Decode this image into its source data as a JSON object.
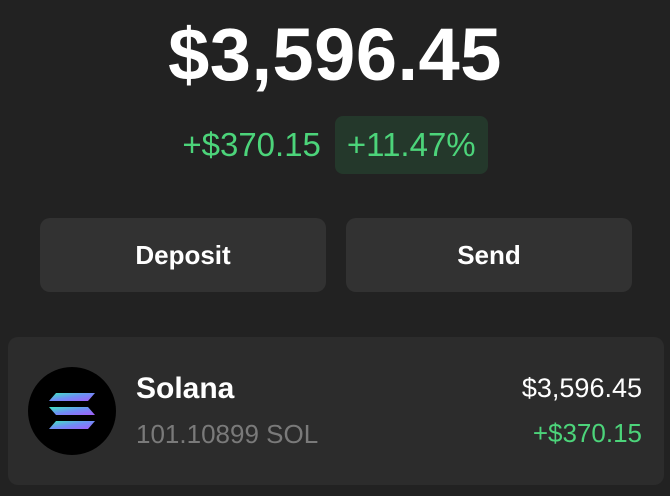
{
  "portfolio": {
    "total_balance": "$3,596.45",
    "change_amount": "+$370.15",
    "change_percent": "+11.47%"
  },
  "actions": {
    "deposit_label": "Deposit",
    "send_label": "Send"
  },
  "tokens": [
    {
      "name": "Solana",
      "amount": "101.10899 SOL",
      "value": "$3,596.45",
      "change": "+$370.15",
      "icon": "solana-logo-icon"
    }
  ],
  "colors": {
    "background": "#222222",
    "positive": "#4cd47a",
    "positive_bg": "#24382b",
    "button_bg": "#323232",
    "card_bg": "#2c2c2c"
  }
}
